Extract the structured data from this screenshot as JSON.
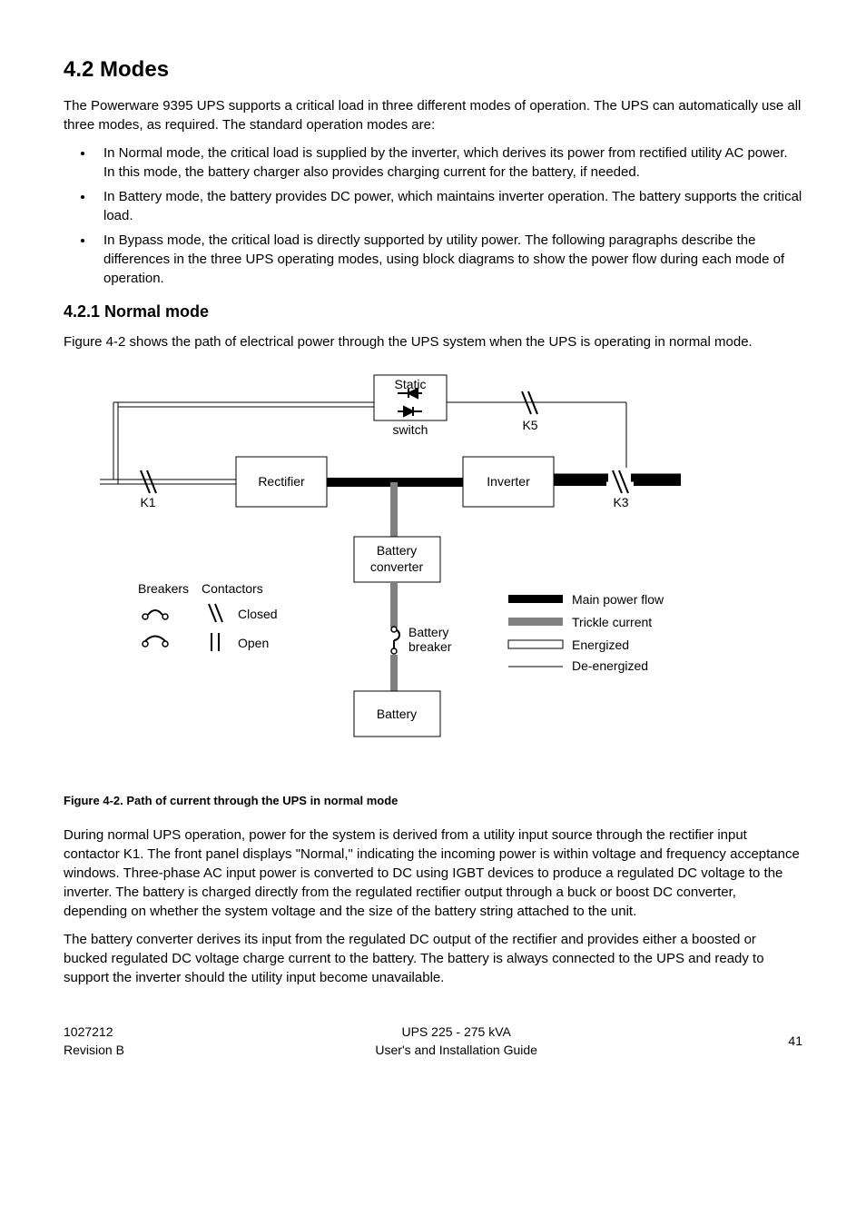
{
  "heading1": "4.2 Modes",
  "intro": "The Powerware 9395 UPS supports a critical load in three different modes of operation. The UPS can automatically use all three modes, as required. The standard operation modes are:",
  "bullets": [
    "In Normal mode, the critical load is supplied by the inverter, which derives its power from rectified utility AC power. In this mode, the battery charger also provides charging current for the battery, if needed.",
    "In Battery mode, the battery provides DC power, which maintains inverter operation. The battery supports the critical load.",
    "In Bypass mode, the critical load is directly supported by utility power. The following paragraphs describe the differences in the three UPS operating modes, using block diagrams to show the power flow during each mode of operation."
  ],
  "heading2": "4.2.1 Normal mode",
  "para_after_h2": "Figure 4-2 shows the path of electrical power through the UPS system when the UPS is operating in normal mode.",
  "figure": {
    "static": "Static",
    "switch": "switch",
    "k5": "K5",
    "rectifier": "Rectifier",
    "inverter": "Inverter",
    "k1": "K1",
    "k3": "K3",
    "battery_converter_1": "Battery",
    "battery_converter_2": "converter",
    "breakers": "Breakers",
    "contactors": "Contactors",
    "closed": "Closed",
    "open": "Open",
    "battery_breaker_1": "Battery",
    "battery_breaker_2": "breaker",
    "main_power_flow": "Main power flow",
    "trickle_current": "Trickle current",
    "energized": "Energized",
    "de_energized": "De-energized",
    "battery": "Battery",
    "caption": "Figure 4-2. Path of current through the UPS in normal mode"
  },
  "para_after_figure": "During normal UPS operation, power for the system is derived from a utility input source through the rectifier input contactor K1. The front panel displays \"Normal,\" indicating the incoming power is within voltage and frequency acceptance windows. Three-phase AC input power is converted to DC using IGBT devices to produce a regulated DC voltage to the inverter. The battery is charged directly from the regulated rectifier output through a buck or boost DC converter, depending on whether the system voltage and the size of the battery string attached to the unit.",
  "para_last": "The battery converter derives its input from the regulated DC output of the rectifier and provides either a boosted or bucked regulated DC voltage charge current to the battery. The battery is always connected to the UPS and ready to support the inverter should the utility input become unavailable.",
  "footer": {
    "left_1": "1027212",
    "left_2": "Revision B",
    "center_1": "UPS 225 - 275 kVA",
    "center_2": "User's and Installation Guide",
    "right": "41"
  }
}
